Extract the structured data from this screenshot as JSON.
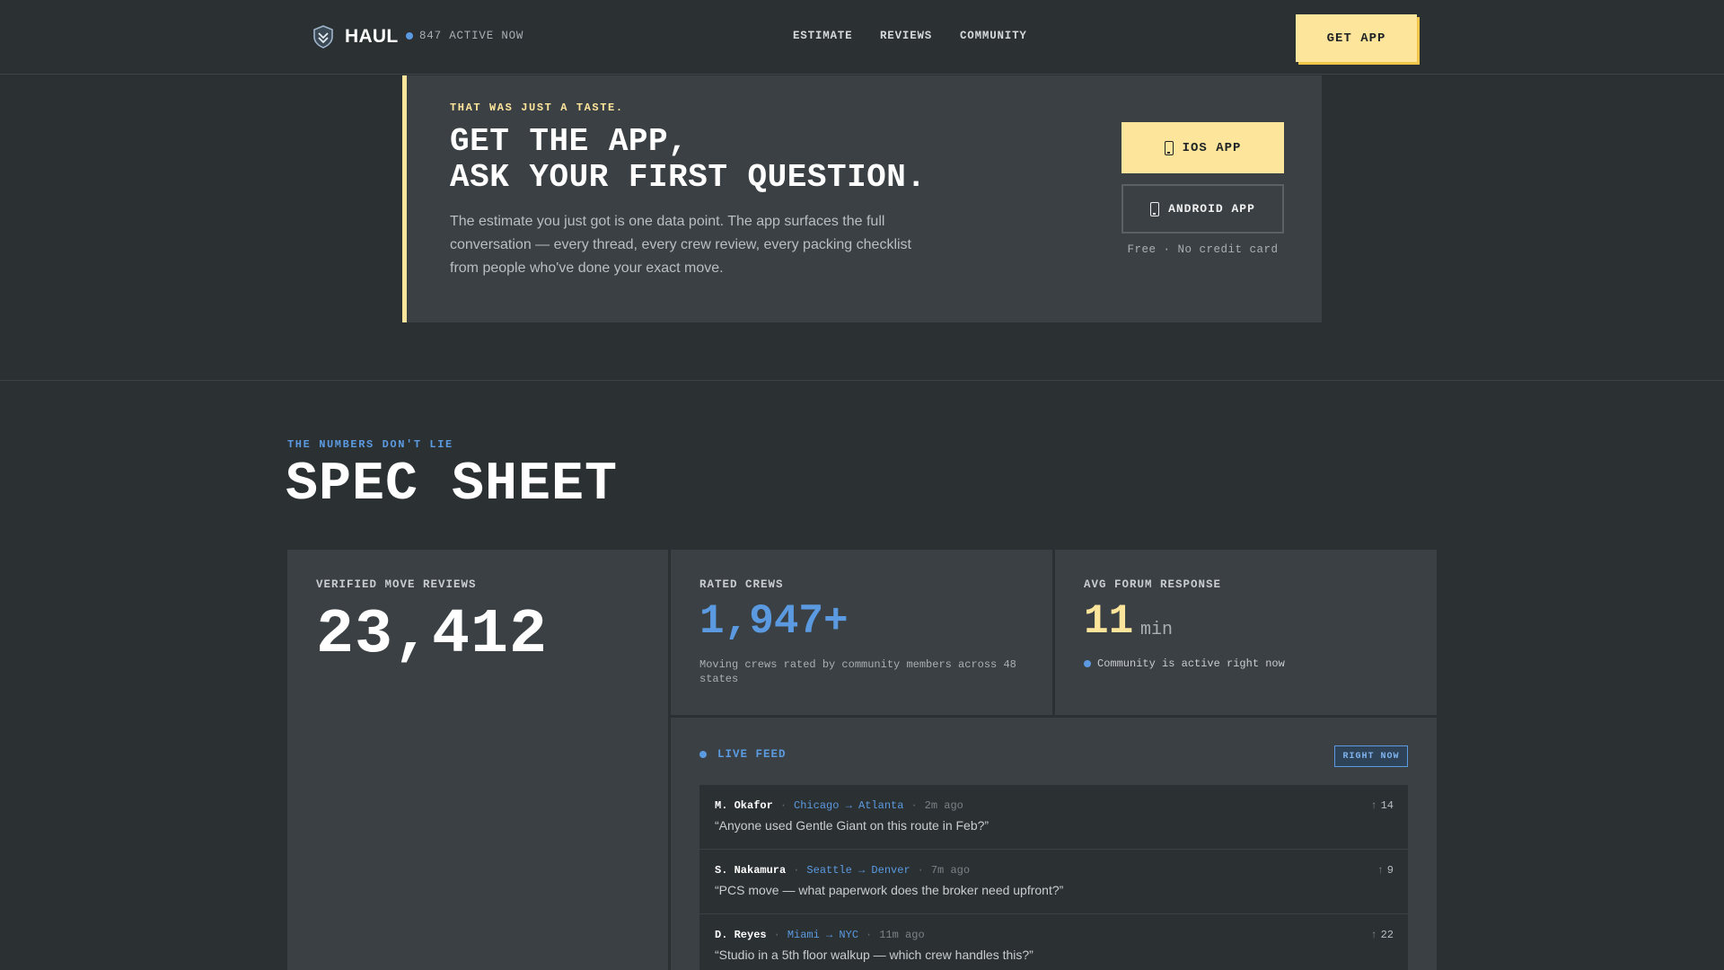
{
  "nav": {
    "brand": "HAUL",
    "active_now": "847 ACTIVE NOW",
    "links": [
      "ESTIMATE",
      "REVIEWS",
      "COMMUNITY"
    ],
    "cta_label": "GET APP"
  },
  "cta_panel": {
    "eyebrow": "THAT WAS JUST A TASTE.",
    "headline_line1": "GET THE APP,",
    "headline_line2": "ASK YOUR FIRST QUESTION.",
    "body": "The estimate you just got is one data point. The app surfaces the full conversation — every thread, every crew review, every packing checklist from people who've done your exact move.",
    "ios_label": "IOS APP",
    "android_label": "ANDROID APP",
    "note": "Free · No credit card"
  },
  "spec": {
    "eyebrow": "THE NUMBERS DON'T LIE",
    "title": "SPEC SHEET",
    "reviews": {
      "label": "VERIFIED MOVE REVIEWS",
      "value": "23,412"
    },
    "crews": {
      "label": "RATED CREWS",
      "value": "1,947+",
      "sub": "Moving crews rated by community members across 48 states"
    },
    "forum": {
      "label": "AVG FORUM RESPONSE",
      "value": "11",
      "unit": "min",
      "status": "Community is active right now"
    },
    "feed": {
      "label": "LIVE FEED",
      "badge": "RIGHT NOW",
      "items": [
        {
          "author": "M. Okafor",
          "route": "Chicago → Atlanta",
          "time": "2m ago",
          "quote": "“Anyone used Gentle Giant on this route in Feb?”",
          "votes": "14"
        },
        {
          "author": "S. Nakamura",
          "route": "Seattle → Denver",
          "time": "7m ago",
          "quote": "“PCS move — what paperwork does the broker need upfront?”",
          "votes": "9"
        },
        {
          "author": "D. Reyes",
          "route": "Miami → NYC",
          "time": "11m ago",
          "quote": "“Studio in a 5th floor walkup — which crew handles this?”",
          "votes": "22"
        }
      ]
    }
  },
  "colors": {
    "background": "#2b3033",
    "panel": "#3a4043",
    "accent_yellow": "#fde59b",
    "accent_blue": "#5b9ae0"
  },
  "icons": {
    "logo": "shield-logo-icon",
    "status": "live-dot-icon",
    "phone": "phone-icon",
    "upvote": "arrow-up-icon"
  }
}
